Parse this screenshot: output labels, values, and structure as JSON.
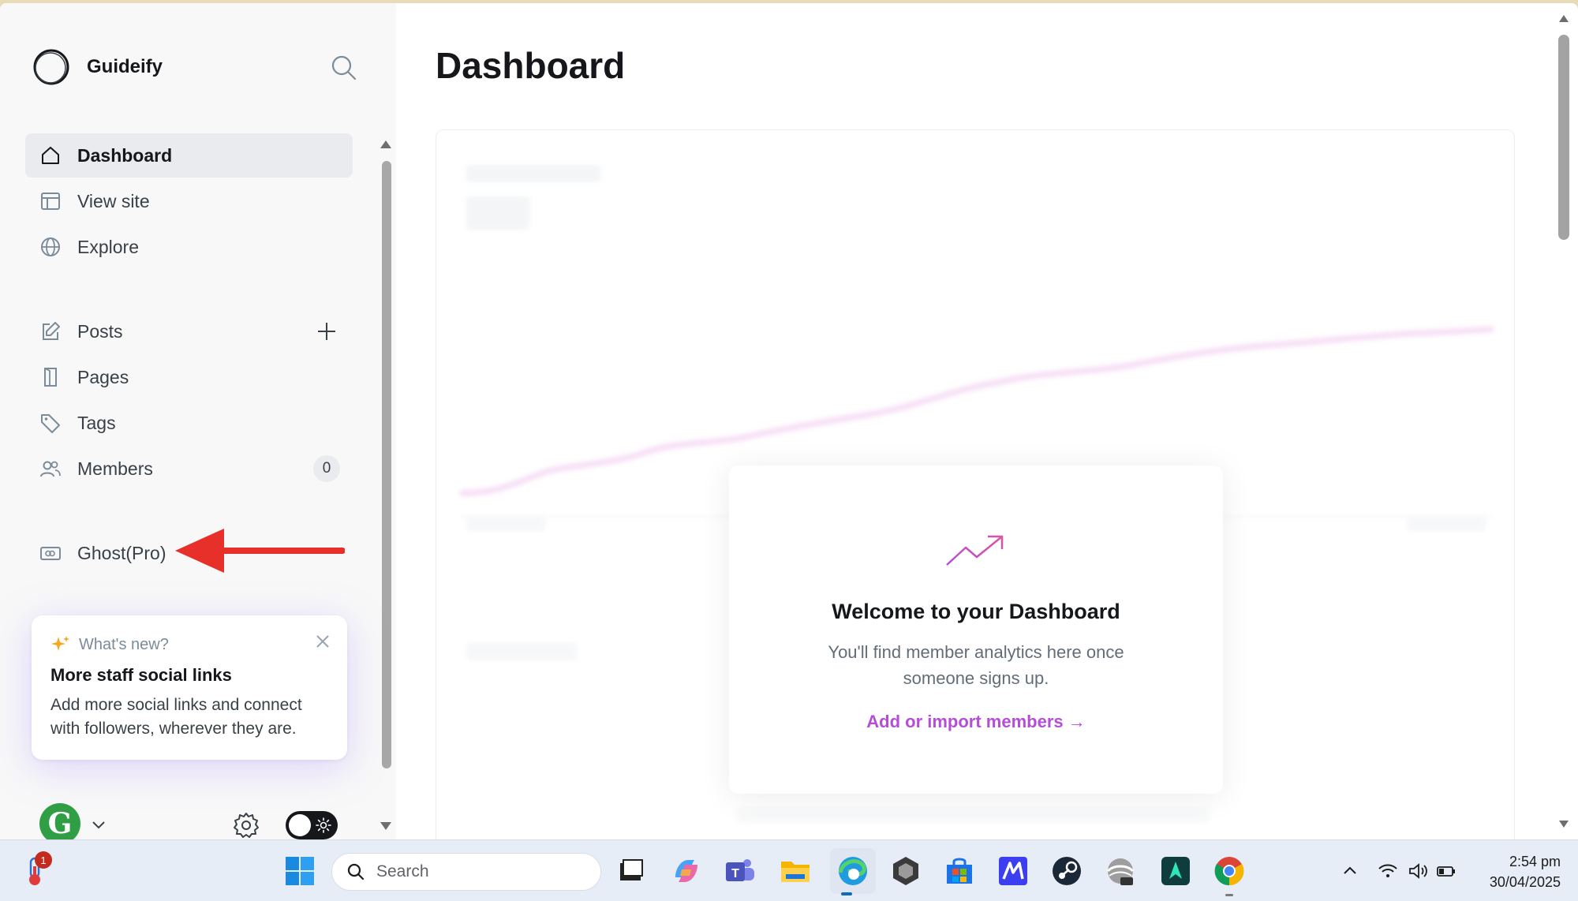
{
  "app": {
    "brand_name": "Guideify"
  },
  "sidebar": {
    "primary_items": [
      {
        "label": "Dashboard",
        "icon": "home-icon",
        "active": true
      },
      {
        "label": "View site",
        "icon": "layout-icon"
      },
      {
        "label": "Explore",
        "icon": "globe-icon"
      }
    ],
    "content_items": [
      {
        "label": "Posts",
        "icon": "edit-icon"
      },
      {
        "label": "Pages",
        "icon": "page-icon"
      },
      {
        "label": "Tags",
        "icon": "tag-icon"
      },
      {
        "label": "Members",
        "icon": "members-icon",
        "badge": "0"
      }
    ],
    "ghost_pro": {
      "label": "Ghost(Pro)",
      "icon": "credit-card-icon"
    },
    "whats_new": {
      "heading": "What's new?",
      "title": "More staff social links",
      "body": "Add more social links and connect with followers, wherever they are."
    },
    "footer": {
      "avatar_letter": "G"
    }
  },
  "main": {
    "title": "Dashboard",
    "welcome": {
      "title": "Welcome to your Dashboard",
      "body": "You'll find member analytics here once someone signs up.",
      "link": "Add or import members →"
    }
  },
  "taskbar": {
    "search_placeholder": "Search",
    "notification_count": "1",
    "time": "2:54 pm",
    "date": "30/04/2025"
  },
  "colors": {
    "accent": "#b44ed6",
    "annotation_arrow": "#e8302a",
    "active_nav_bg": "#e9ebee"
  }
}
